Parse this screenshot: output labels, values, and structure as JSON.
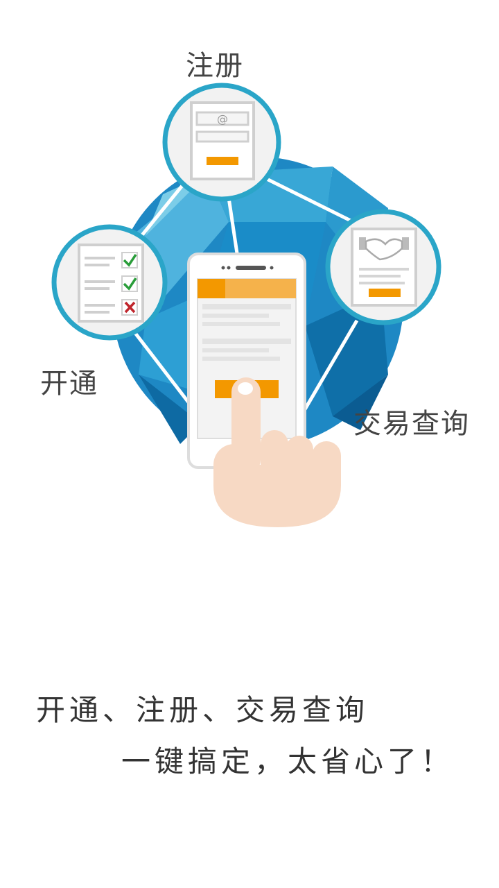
{
  "labels": {
    "register": "注册",
    "open": "开通",
    "query": "交易查询"
  },
  "form_icon": {
    "at_symbol": "@"
  },
  "tagline": {
    "line1": "开通、注册、交易查询",
    "line2": "一键搞定，太省心了！"
  },
  "colors": {
    "globe_blue": "#1e88c4",
    "circle_border": "#2aa5c8",
    "accent_orange": "#f39800",
    "skin": "#f7d9c4",
    "check_green": "#2a9d3a",
    "cross_red": "#c0262d"
  },
  "icons": {
    "globe": "globe-illustration",
    "register": "registration-form-icon",
    "open": "checklist-icon",
    "query": "handshake-document-icon",
    "phone": "smartphone-icon",
    "hand": "pointing-hand-icon"
  }
}
